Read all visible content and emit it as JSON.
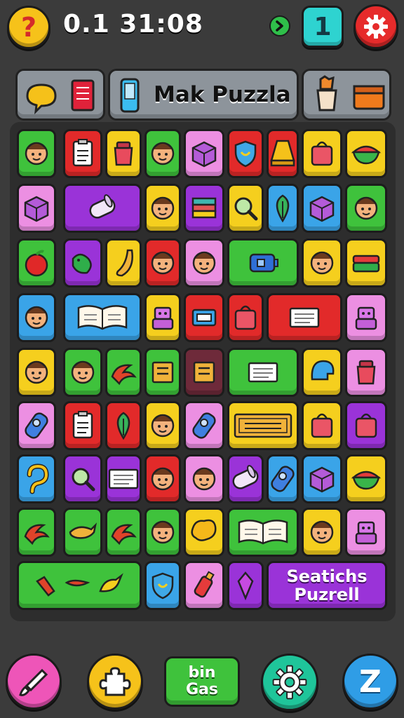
{
  "hud": {
    "timer": "0.1 31:08",
    "level": "1",
    "help_glyph": "?"
  },
  "header": {
    "title": "Mak Puzzla",
    "left_icons": [
      "speech-bubble-icon",
      "notebook-icon"
    ],
    "mid_icon": "phone-icon",
    "right_icons": [
      "cup-icon",
      "box-icon"
    ]
  },
  "board": {
    "action_tile": {
      "line1": "Seatichs",
      "line2": "Puzrell"
    },
    "colors": {
      "green": "#3fc23c",
      "red": "#e22a2a",
      "yellow": "#f5cf1e",
      "purple": "#9a33d8",
      "pink": "#ec8fe2",
      "blue": "#3aa4e8",
      "darkred": "#6e2a3a"
    }
  },
  "bottom": {
    "bingas_label": "bin\nGas",
    "z_glyph": "Z",
    "icons": [
      "paintbrush-icon",
      "puzzle-piece-icon",
      "gear-icon",
      "z-icon"
    ]
  }
}
